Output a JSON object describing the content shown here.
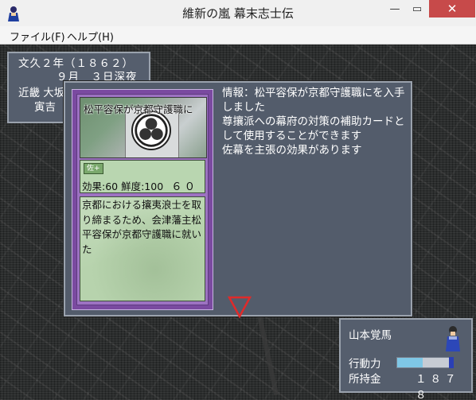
{
  "window": {
    "title": "維新の嵐 幕末志士伝",
    "minimize": "—",
    "maximize": "▭",
    "close": "✕"
  },
  "menu": {
    "file": "ファイル(F)",
    "help": "ヘルプ(H)"
  },
  "date_panel": {
    "year": "文久２年（１８６２）",
    "day": "９月　３日深夜",
    "location": "近畿 大坂",
    "weather": "寅吉"
  },
  "info": {
    "text": "情報：松平容保が京都守護職にを入手しました\n尊攘派への幕府の対策の補助カードとして使用することができます\n佐幕を主張の効果があります"
  },
  "card": {
    "title": "松平容保が京都守護職に",
    "badge": "佐+",
    "effect_label": "効果:60 鮮度:100",
    "effect_value": "６０",
    "description": "京都における攘夷浪士を取り締まるため、会津藩主松平容保が京都守護職に就いた"
  },
  "character": {
    "name": "山本覚馬",
    "action_label": "行動力",
    "action_level": 0.45,
    "money_label": "所持金",
    "money_value": "１８７８"
  },
  "colors": {
    "panel_bg": "#555e6d",
    "card_purple": "#9d72c2",
    "card_green": "#b9d6b0",
    "arrow_red": "#e02a2a",
    "action_fill": "#7fc7e6"
  }
}
